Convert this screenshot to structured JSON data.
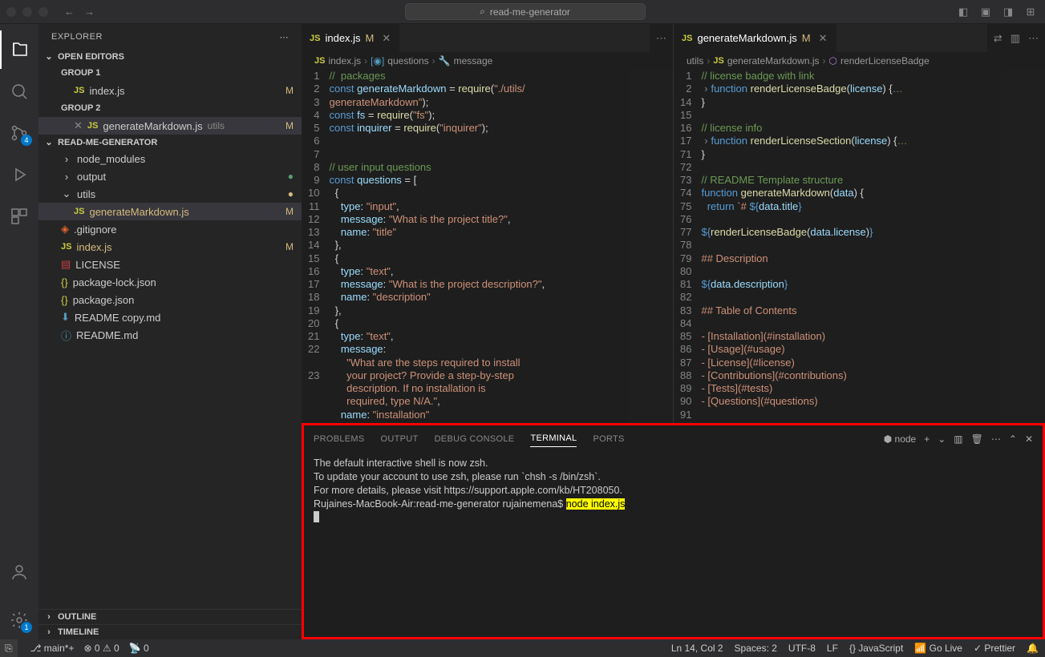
{
  "titlebar": {
    "search": "read-me-generator"
  },
  "activity": {
    "scm_badge": "4",
    "settings_badge": "1"
  },
  "sidebar": {
    "title": "EXPLORER",
    "open_editors": "OPEN EDITORS",
    "group1": "GROUP 1",
    "group2": "GROUP 2",
    "ed1": "index.js",
    "ed1_status": "M",
    "ed2": "generateMarkdown.js",
    "ed2_folder": "utils",
    "ed2_status": "M",
    "project": "READ-ME-GENERATOR",
    "files": {
      "node_modules": "node_modules",
      "output": "output",
      "utils": "utils",
      "genmd": "generateMarkdown.js",
      "genmd_status": "M",
      "gitignore": ".gitignore",
      "indexjs": "index.js",
      "indexjs_status": "M",
      "license": "LICENSE",
      "pkglock": "package-lock.json",
      "pkg": "package.json",
      "readmecopy": "README copy.md",
      "readme": "README.md"
    },
    "outline": "OUTLINE",
    "timeline": "TIMELINE"
  },
  "tabs": {
    "left": {
      "label": "index.js",
      "mark": "M"
    },
    "right": {
      "label": "generateMarkdown.js",
      "mark": "M"
    }
  },
  "breadcrumbs": {
    "left": [
      "index.js",
      "questions",
      "message"
    ],
    "right": [
      "utils",
      "generateMarkdown.js",
      "renderLicenseBadge"
    ]
  },
  "code_left": {
    "lines": [
      "1",
      "2",
      "3",
      "4",
      "5",
      "6",
      "7",
      "8",
      "9",
      "10",
      "11",
      "12",
      "13",
      "14",
      "15",
      "16",
      "17",
      "18",
      "19",
      "20",
      "21",
      "22",
      "",
      "23"
    ],
    "l1": "//  packages",
    "l2a": "const ",
    "l2b": "generateMarkdown",
    "l2c": " = ",
    "l2d": "require",
    "l2e": "(",
    "l2f": "\"./utils/generateMarkdown\"",
    "l2g": ");",
    "l3a": "const ",
    "l3b": "fs",
    "l3c": " = ",
    "l3d": "require",
    "l3e": "(",
    "l3f": "\"fs\"",
    "l3g": ");",
    "l4a": "const ",
    "l4b": "inquirer",
    "l4c": " = ",
    "l4d": "require",
    "l4e": "(",
    "l4f": "\"inquirer\"",
    "l4g": ");",
    "l7": "// user input questions",
    "l8a": "const ",
    "l8b": "questions",
    "l8c": " = [",
    "l9": "  {",
    "l10a": "    type",
    "l10b": ": ",
    "l10c": "\"input\"",
    "l10d": ",",
    "l11a": "    message",
    "l11b": ": ",
    "l11c": "\"What is the project title?\"",
    "l11d": ",",
    "l12a": "    name",
    "l12b": ": ",
    "l12c": "\"title\"",
    "l13": "  },",
    "l14": "  {",
    "l15a": "    type",
    "l15b": ": ",
    "l15c": "\"text\"",
    "l15d": ",",
    "l16a": "    message",
    "l16b": ": ",
    "l16c": "\"What is the project description?\"",
    "l16d": ",",
    "l17a": "    name",
    "l17b": ": ",
    "l17c": "\"description\"",
    "l18": "  },",
    "l19": "  {",
    "l20a": "    type",
    "l20b": ": ",
    "l20c": "\"text\"",
    "l20d": ",",
    "l21a": "    message",
    "l21b": ":",
    "l22": "      \"What are the steps required to install your project? Provide a step-by-step description. If no installation is required, type N/A.\"",
    "l22d": ",",
    "l23a": "    name",
    "l23b": ": ",
    "l23c": "\"installation\""
  },
  "code_right": {
    "lines": [
      "1",
      "2",
      "14",
      "15",
      "16",
      "17",
      "71",
      "72",
      "73",
      "74",
      "75",
      "76",
      "77",
      "78",
      "79",
      "80",
      "81",
      "82",
      "83",
      "84",
      "85",
      "86",
      "87",
      "88",
      "89",
      "90",
      "91"
    ],
    "l1": "// license badge with link",
    "l2a": "function ",
    "l2b": "renderLicenseBadge",
    "l2c": "(",
    "l2d": "license",
    "l2e": ") {",
    "l2f": "…",
    "l14": "}",
    "l16": "// license info",
    "l17a": "function ",
    "l17b": "renderLicenseSection",
    "l17c": "(",
    "l17d": "license",
    "l17e": ") {",
    "l17f": "…",
    "l71": "}",
    "l73": "// README Template structure",
    "l74a": "function ",
    "l74b": "generateMarkdown",
    "l74c": "(",
    "l74d": "data",
    "l74e": ") {",
    "l75a": "  return ",
    "l75b": "`# ",
    "l75c": "${",
    "l75d": "data",
    "l75e": ".",
    "l75f": "title",
    "l75g": "}",
    "l77a": "${",
    "l77b": "renderLicenseBadge",
    "l77c": "(",
    "l77d": "data",
    "l77e": ".",
    "l77f": "license",
    "l77g": ")",
    "l77h": "}",
    "l79": "## Description",
    "l81a": "${",
    "l81b": "data",
    "l81c": ".",
    "l81d": "description",
    "l81e": "}",
    "l83": "## Table of Contents",
    "l85": "- [Installation](#installation)",
    "l86": "- [Usage](#usage)",
    "l87": "- [License](#license)",
    "l88": "- [Contributions](#contributions)",
    "l89": "- [Tests](#tests)",
    "l90": "- [Questions](#questions)"
  },
  "panel": {
    "tabs": {
      "problems": "PROBLEMS",
      "output": "OUTPUT",
      "debug": "DEBUG CONSOLE",
      "terminal": "TERMINAL",
      "ports": "PORTS"
    },
    "shell": "node",
    "term_l1": "The default interactive shell is now zsh.",
    "term_l2": "To update your account to use zsh, please run `chsh -s /bin/zsh`.",
    "term_l3": "For more details, please visit https://support.apple.com/kb/HT208050.",
    "term_prompt": "Rujaines-MacBook-Air:read-me-generator rujainemena$ ",
    "term_cmd": "node index.js"
  },
  "status": {
    "branch": "main*+",
    "errors": "0",
    "warnings": "0",
    "port": "0",
    "pos": "Ln 14, Col 2",
    "spaces": "Spaces: 2",
    "enc": "UTF-8",
    "eol": "LF",
    "lang": "JavaScript",
    "golive": "Go Live",
    "prettier": "Prettier"
  }
}
